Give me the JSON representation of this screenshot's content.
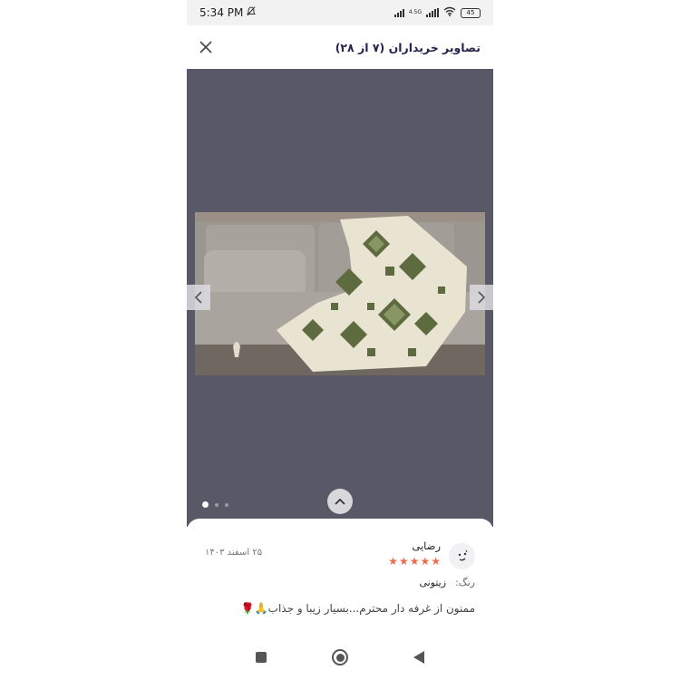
{
  "status_bar": {
    "time": "5:34 PM",
    "battery": "45",
    "network": "4.5G",
    "icons": [
      "mute-icon",
      "signal-icon",
      "wifi-icon",
      "battery-icon"
    ]
  },
  "header": {
    "title": "تصاویر خریداران (۷ از ۲۸)",
    "close_icon": "close-icon"
  },
  "viewer": {
    "photo_subject": "sofa-with-geometric-throw",
    "prev_icon": "chevron-left-icon",
    "next_icon": "chevron-right-icon",
    "expand_icon": "chevron-up-icon",
    "dots_count": 3,
    "active_dot": 0
  },
  "review": {
    "name": "رضایی",
    "rating": 5,
    "date": "۲۵ اسفند ۱۴۰۳",
    "color_label": "رنگ:",
    "color_value": "زیتونی",
    "comment": "ممنون از غرفه دار محترم...بسیار زیبا و جذاب🙏🌹"
  },
  "colors": {
    "viewer_bg": "#595867",
    "star": "#f06a4b",
    "title": "#23254e"
  }
}
